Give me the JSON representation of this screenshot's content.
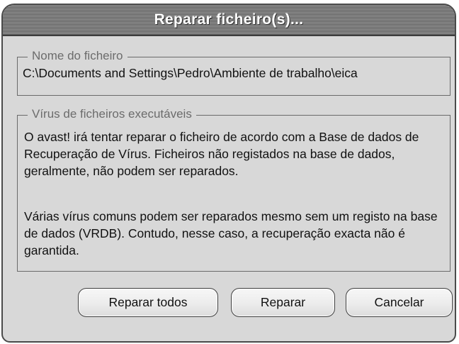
{
  "window": {
    "title": "Reparar ficheiro(s)..."
  },
  "file_group": {
    "label": "Nome do ficheiro",
    "path": "C:\\Documents and Settings\\Pedro\\Ambiente de trabalho\\eica"
  },
  "virus_group": {
    "label": "Vírus de ficheiros executáveis",
    "paragraph1": "O avast! irá tentar reparar o ficheiro de acordo com a Base de dados de Recuperação de Vírus. Ficheiros não registados na base de dados, geralmente, não podem ser reparados.",
    "paragraph2": "Várias vírus comuns podem ser reparados mesmo sem um registo na base de dados (VRDB). Contudo, nesse caso, a recuperação exacta não é garantida."
  },
  "buttons": {
    "repair_all": "Reparar todos",
    "repair": "Reparar",
    "cancel": "Cancelar"
  }
}
